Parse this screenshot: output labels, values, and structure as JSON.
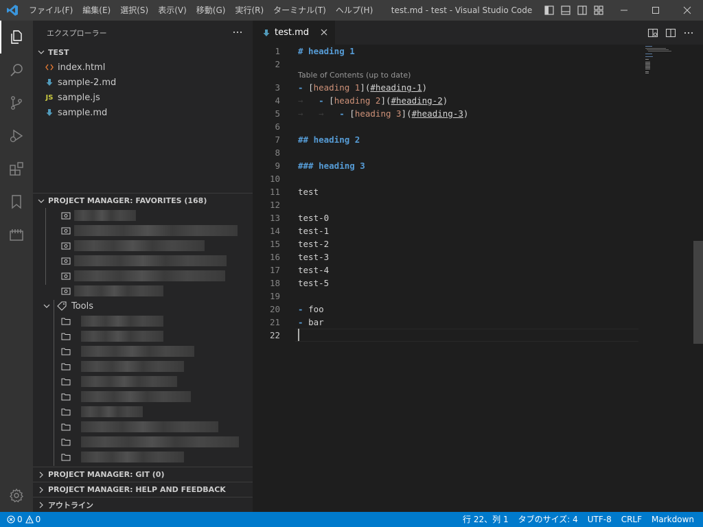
{
  "titlebar": {
    "menu": [
      "ファイル(F)",
      "編集(E)",
      "選択(S)",
      "表示(V)",
      "移動(G)",
      "実行(R)",
      "ターミナル(T)",
      "ヘルプ(H)"
    ],
    "window_title": "test.md - test - Visual Studio Code"
  },
  "activitybar": {
    "items": [
      "explorer-icon",
      "search-icon",
      "source-control-icon",
      "run-debug-icon",
      "extensions-icon",
      "bookmarks-icon",
      "project-manager-icon"
    ],
    "bottom": [
      "settings-gear-icon"
    ]
  },
  "sidebar": {
    "title": "エクスプローラー",
    "folder": "TEST",
    "files": [
      {
        "name": "index.html",
        "icon": "html-icon",
        "color": "#e37933"
      },
      {
        "name": "sample-2.md",
        "icon": "markdown-icon",
        "color": "#519aba"
      },
      {
        "name": "sample.js",
        "icon": "js-icon",
        "color": "#cbcb41"
      },
      {
        "name": "sample.md",
        "icon": "markdown-icon",
        "color": "#519aba"
      }
    ],
    "pm_favorites": "PROJECT MANAGER: FAVORITES (168)",
    "tools_label": "Tools",
    "pm_git": "PROJECT MANAGER: GIT (0)",
    "pm_help": "PROJECT MANAGER: HELP AND FEEDBACK",
    "outline": "アウトライン"
  },
  "editor": {
    "tab": "test.md",
    "codelens": "Table of Contents (up to date)",
    "line_numbers": [
      "1",
      "2",
      "3",
      "4",
      "5",
      "6",
      "7",
      "8",
      "9",
      "10",
      "11",
      "12",
      "13",
      "14",
      "15",
      "16",
      "17",
      "18",
      "19",
      "20",
      "21",
      "22"
    ],
    "plain_lines": {
      "test": "test",
      "t0": "test-0",
      "t1": "test-1",
      "t2": "test-2",
      "t3": "test-3",
      "t4": "test-4",
      "t5": "test-5",
      "foo": "foo",
      "bar": "bar"
    },
    "h1": "# heading 1",
    "h2": "## heading 2",
    "h3": "### heading 3",
    "toc1_text": "heading 1",
    "toc1_url": "#heading-1",
    "toc2_text": "heading 2",
    "toc2_url": "#heading-2",
    "toc3_text": "heading 3",
    "toc3_url": "#heading-3",
    "current_line": 22
  },
  "statusbar": {
    "errors": "0",
    "warnings": "0",
    "position": "行 22、列 1",
    "tab_size": "タブのサイズ: 4",
    "encoding": "UTF-8",
    "eol": "CRLF",
    "language": "Markdown"
  },
  "colors": {
    "accent": "#007acc",
    "heading": "#569cd6",
    "link_text": "#ce9178"
  }
}
